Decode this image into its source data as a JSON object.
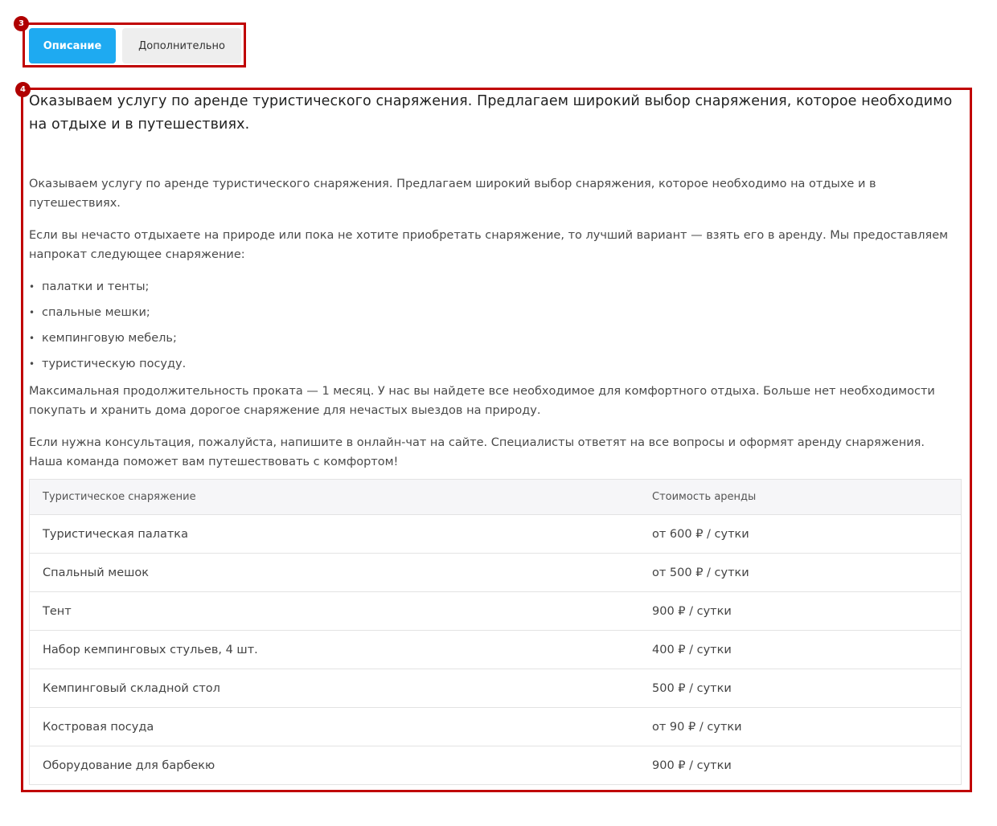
{
  "annotations": {
    "tabs_marker": "3",
    "content_marker": "4",
    "frame_color": "#c00000"
  },
  "tabs": [
    {
      "label": "Описание",
      "active": true
    },
    {
      "label": "Дополнительно",
      "active": false
    }
  ],
  "colors": {
    "accent": "#1eaaf1",
    "tab_inactive_bg": "#eeeeee"
  },
  "content": {
    "lead": "Оказываем услугу по аренде туристического снаряжения. Предлагаем широкий выбор снаряжения, которое необходимо на отдыхе и в путешествиях.",
    "paragraph1": "Оказываем услугу по аренде туристического снаряжения. Предлагаем широкий выбор снаряжения, которое необходимо на отдыхе и в путешествиях.",
    "paragraph2": "Если вы нечасто отдыхаете на природе или пока не хотите приобретать снаряжение, то лучший вариант — взять его в аренду. Мы предоставляем напрокат следующее снаряжение:",
    "list": [
      "палатки и тенты;",
      "спальные мешки;",
      "кемпинговую мебель;",
      "туристическую посуду."
    ],
    "paragraph3": "Максимальная продолжительность проката — 1 месяц. У нас вы найдете все необходимое для комфортного отдыха. Больше нет необходимости покупать и хранить дома дорогое снаряжение для нечастых выездов на природу.",
    "paragraph4": "Если нужна консультация, пожалуйста, напишите в онлайн-чат на сайте. Специалисты ответят на все вопросы и оформят аренду снаряжения. Наша команда поможет вам путешествовать с комфортом!"
  },
  "table": {
    "headers": [
      "Туристическое снаряжение",
      "Стоимость аренды"
    ],
    "rows": [
      [
        "Туристическая палатка",
        "от 600 ₽ / сутки"
      ],
      [
        "Спальный мешок",
        "от 500 ₽ / сутки"
      ],
      [
        "Тент",
        "900 ₽ / сутки"
      ],
      [
        "Набор кемпинговых стульев, 4 шт.",
        "400 ₽ / сутки"
      ],
      [
        "Кемпинговый складной стол",
        "500 ₽ / сутки"
      ],
      [
        "Костровая посуда",
        "от 90 ₽ / сутки"
      ],
      [
        "Оборудование для барбекю",
        "900 ₽ / сутки"
      ]
    ]
  }
}
